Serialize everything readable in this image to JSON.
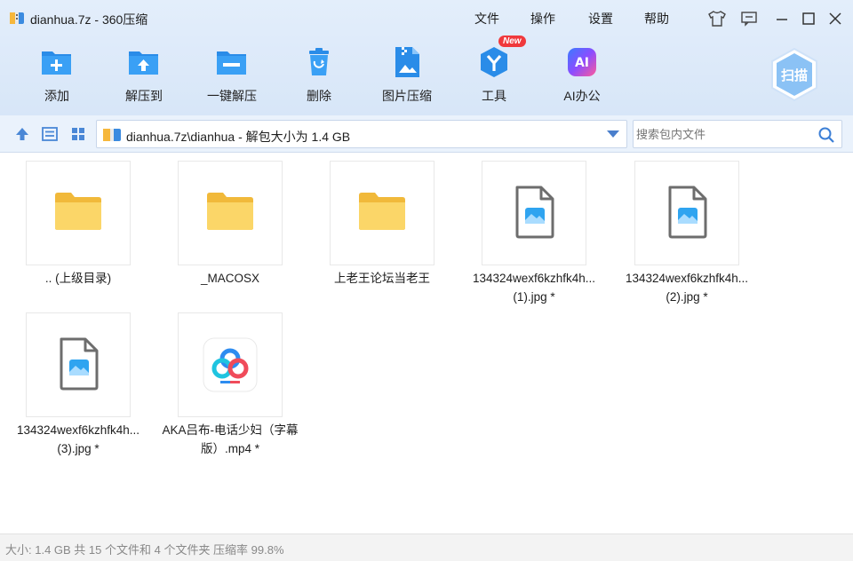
{
  "window": {
    "title": "dianhua.7z - 360压缩"
  },
  "menu": [
    "文件",
    "操作",
    "设置",
    "帮助"
  ],
  "toolbar": [
    {
      "label": "添加",
      "icon": "add-icon"
    },
    {
      "label": "解压到",
      "icon": "extract-to-icon"
    },
    {
      "label": "一键解压",
      "icon": "one-click-extract-icon"
    },
    {
      "label": "删除",
      "icon": "delete-icon"
    },
    {
      "label": "图片压缩",
      "icon": "image-compress-icon"
    },
    {
      "label": "工具",
      "icon": "tools-icon"
    },
    {
      "label": "AI办公",
      "icon": "ai-office-icon"
    }
  ],
  "badge": "New",
  "scan_label": "扫描",
  "address": {
    "path": "dianhua.7z\\dianhua - 解包大小为 1.4 GB"
  },
  "search": {
    "placeholder": "搜索包内文件"
  },
  "items": [
    {
      "name": ".. (上级目录)",
      "type": "folder"
    },
    {
      "name": "_MACOSX",
      "type": "folder"
    },
    {
      "name": "上老王论坛当老王",
      "type": "folder"
    },
    {
      "name": "134324wexf6kzhfk4h... (1).jpg *",
      "type": "image"
    },
    {
      "name": "134324wexf6kzhfk4h... (2).jpg *",
      "type": "image"
    },
    {
      "name": "134324wexf6kzhfk4h... (3).jpg *",
      "type": "image"
    },
    {
      "name": "AKA吕布-电话少妇（字幕版）.mp4 *",
      "type": "video"
    }
  ],
  "status": "大小: 1.4 GB 共 15 个文件和 4 个文件夹 压缩率 99.8%",
  "colors": {
    "accent": "#2a8ce8",
    "folder": "#f7c948",
    "toolbar_bg": "#dce9f9"
  }
}
